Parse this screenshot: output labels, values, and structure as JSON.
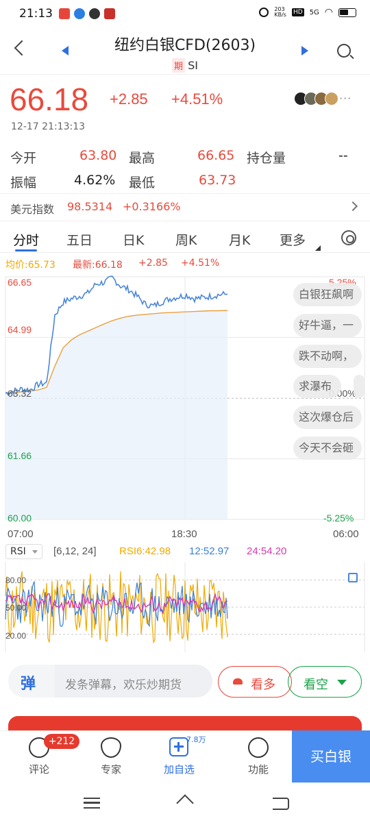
{
  "status_bar": {
    "time": "21:13",
    "net_speed": "203\nKB/s",
    "network": "5G"
  },
  "header": {
    "title": "纽约白银CFD(2603)",
    "tag": "期",
    "code": "SI"
  },
  "quote": {
    "price": "66.18",
    "change": "+2.85",
    "change_pct": "+4.51%",
    "datetime": "12-17  21:13:13",
    "more": "···"
  },
  "stats": {
    "open_label": "今开",
    "open": "63.80",
    "high_label": "最高",
    "high": "66.65",
    "oi_label": "持仓量",
    "oi": "--",
    "amp_label": "振幅",
    "amp": "4.62%",
    "low_label": "最低",
    "low": "63.73"
  },
  "usd_index": {
    "label": "美元指数",
    "value": "98.5314",
    "change": "+0.3166%"
  },
  "tabs": [
    "分时",
    "五日",
    "日K",
    "周K",
    "月K",
    "更多"
  ],
  "legend": {
    "avg": "均价:65.73",
    "last": "最新:66.18",
    "chg": "+2.85",
    "pct": "+4.51%"
  },
  "y_labels": {
    "top": "66.65",
    "upper": "64.99",
    "mid": "63.32",
    "lower": "61.66",
    "bottom": "60.00",
    "pct_top": "5.25%",
    "pct_mid": "0.00%",
    "pct_bottom": "-5.25%"
  },
  "x_labels": {
    "start": "07:00",
    "mid": "18:30",
    "end": "06:00"
  },
  "danmaku": [
    "白银狂飙啊",
    "好牛逼，一",
    "跌不动啊，",
    "求瀑布",
    "这次爆仓后",
    "今天不会砸"
  ],
  "rsi": {
    "button": "RSI",
    "params": "[6,12,  24]",
    "rsi6": "RSI6:42.98",
    "rsi12": "12:52.97",
    "rsi24": "24:54.20",
    "levels": [
      "80.00",
      "50.00",
      "20.00"
    ]
  },
  "comment_bar": {
    "icon": "弹",
    "placeholder": "发条弹幕，欢乐炒期货",
    "bull": "看多",
    "bear": "看空"
  },
  "bottom_nav": {
    "comment": "评论",
    "comment_badge": "+212",
    "expert": "专家",
    "follow": "加自选",
    "follow_count": "7.8万",
    "function": "功能",
    "buy": "买白银"
  },
  "colors": {
    "up": "#e84a3c",
    "down": "#1aa34a",
    "price_line": "#4a86d9",
    "avg_line": "#e8a040",
    "accent": "#2f6fe0"
  },
  "chart_data": {
    "type": "line",
    "ylim": [
      60.0,
      66.65
    ],
    "x_ticks": [
      "07:00",
      "18:30",
      "06:00"
    ],
    "series": [
      {
        "name": "最新",
        "values": [
          63.46,
          63.52,
          63.58,
          63.55,
          63.7,
          63.74,
          65.6,
          65.95,
          66.05,
          66.12,
          66.2,
          66.45,
          66.5,
          66.62,
          66.4,
          66.3,
          66.12,
          65.9,
          65.85,
          65.96,
          66.05,
          66.1,
          66.15,
          66.05,
          66.08,
          66.12,
          66.16,
          66.18
        ]
      },
      {
        "name": "均价",
        "values": [
          63.46,
          63.47,
          63.5,
          63.52,
          63.55,
          63.62,
          64.2,
          64.7,
          64.92,
          65.06,
          65.16,
          65.26,
          65.36,
          65.45,
          65.52,
          65.57,
          65.6,
          65.62,
          65.64,
          65.66,
          65.67,
          65.68,
          65.69,
          65.7,
          65.71,
          65.72,
          65.72,
          65.73
        ]
      }
    ]
  }
}
